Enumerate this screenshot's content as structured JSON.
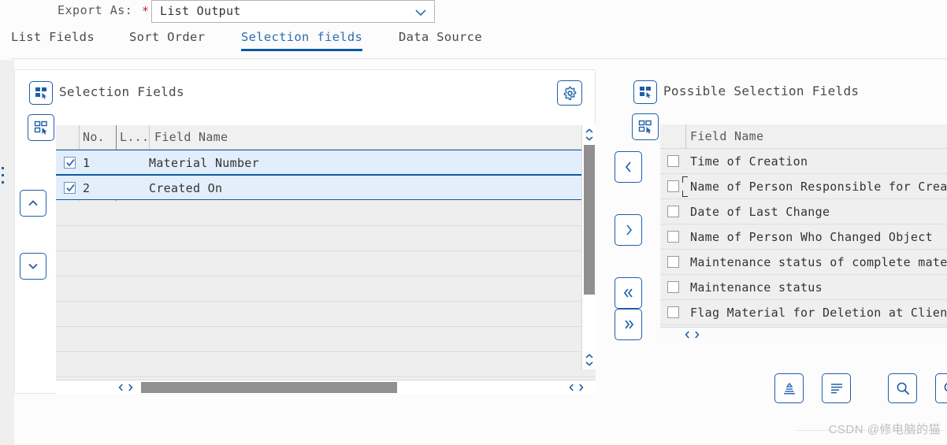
{
  "topbar": {
    "export_label": "Export As:",
    "required_marker": "*",
    "dropdown": {
      "value": "List Output",
      "icon": "chevron-down-icon"
    }
  },
  "tabs": [
    {
      "label": "List Fields",
      "active": false
    },
    {
      "label": "Sort Order",
      "active": false
    },
    {
      "label": "Selection fields",
      "active": true
    },
    {
      "label": "Data Source",
      "active": false
    }
  ],
  "left_panel": {
    "title": "Selection Fields",
    "title_icon": "select-all-pointer-icon",
    "table_icon": "select-rows-pointer-icon",
    "settings_icon": "gear-icon",
    "columns": [
      "",
      "No.",
      "L...",
      "Field Name"
    ],
    "rows": [
      {
        "checked": true,
        "no": "1",
        "length": "",
        "field_name": "Material Number"
      },
      {
        "checked": true,
        "no": "2",
        "length": "",
        "field_name": "Created On"
      }
    ],
    "empty_row_count": 7,
    "move_up_icon": "chevron-up-icon",
    "move_down_icon": "chevron-down-icon"
  },
  "transfer_buttons": [
    {
      "name": "move-left-button",
      "glyph": "‹",
      "icon": "chevron-left-icon"
    },
    {
      "name": "move-right-button",
      "glyph": "›",
      "icon": "chevron-right-icon"
    },
    {
      "name": "move-all-left-button",
      "glyph": "«",
      "icon": "double-chevron-left-icon"
    },
    {
      "name": "move-all-right-button",
      "glyph": "»",
      "icon": "double-chevron-right-icon"
    }
  ],
  "right_panel": {
    "title": "Possible Selection Fields",
    "title_icon": "select-all-pointer-icon",
    "table_icon": "select-rows-pointer-icon",
    "columns": [
      "",
      "Field Name"
    ],
    "rows": [
      {
        "checked": false,
        "field_name": "Time of Creation",
        "focused": false
      },
      {
        "checked": false,
        "field_name": "Name of Person Responsible for Creati",
        "focused": true
      },
      {
        "checked": false,
        "field_name": "Date of Last Change",
        "focused": false
      },
      {
        "checked": false,
        "field_name": "Name of Person Who Changed Object",
        "focused": false
      },
      {
        "checked": false,
        "field_name": "Maintenance status of complete materi",
        "focused": false
      },
      {
        "checked": false,
        "field_name": "Maintenance status",
        "focused": false
      },
      {
        "checked": false,
        "field_name": "Flag Material for Deletion at Client",
        "focused": false
      }
    ]
  },
  "action_buttons": [
    {
      "name": "sort-ascending-button",
      "icon": "sort-ascending-icon"
    },
    {
      "name": "filter-button",
      "icon": "filter-lines-icon"
    },
    {
      "name": "search-button",
      "icon": "search-icon"
    },
    {
      "name": "find-next-button",
      "icon": "search-icon"
    }
  ],
  "scroll": {
    "left_v_up_icon": "chevron-up-icon",
    "left_v_down_icon": "chevron-down-icon",
    "left_h_left_icon": "chevron-left-icon",
    "left_h_right_icon": "chevron-right-icon"
  },
  "watermark": {
    "text": "CSDN @修电脑的猫"
  },
  "colors": {
    "accent": "#1e5fa8",
    "tab_active": "#2E6DB4",
    "tab_underline": "#0a5aa5",
    "required": "#c1272d",
    "row_selected_bg": "#e2eefb",
    "row_empty_bg": "#eeeeee",
    "header_bg": "#f0f0f0",
    "scroll_thumb": "#909090",
    "watermark": "#bfbfbf"
  }
}
